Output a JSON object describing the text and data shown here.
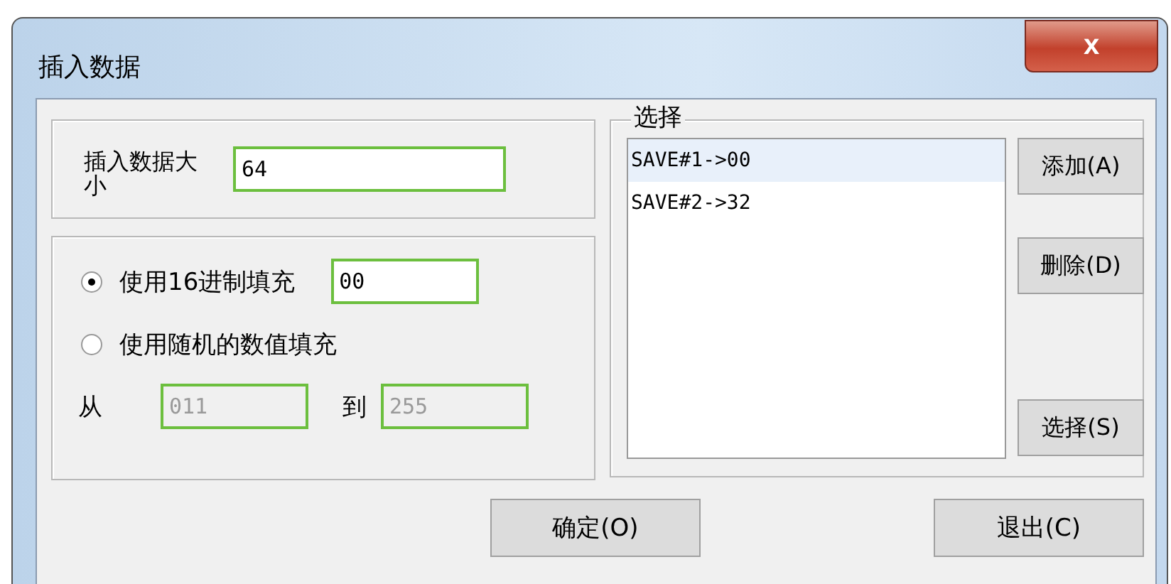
{
  "window": {
    "title": "插入数据",
    "close": "x"
  },
  "size": {
    "label": "插入数据大小",
    "value": "64"
  },
  "fill": {
    "options": [
      {
        "label": "使用16进制填充",
        "selected": true,
        "value": "00"
      },
      {
        "label": "使用随机的数值填充",
        "selected": false
      }
    ],
    "from_label": "从",
    "from_value": "011",
    "to_label": "到",
    "to_value": "255",
    "range_disabled": true
  },
  "select": {
    "legend": "选择",
    "items": [
      {
        "text": "SAVE#1->00",
        "selected": true
      },
      {
        "text": "SAVE#2->32",
        "selected": false
      }
    ],
    "buttons": [
      "添加(A)",
      "删除(D)",
      "选择(S)"
    ]
  },
  "buttons": [
    "确定(O)",
    "退出(C)"
  ]
}
